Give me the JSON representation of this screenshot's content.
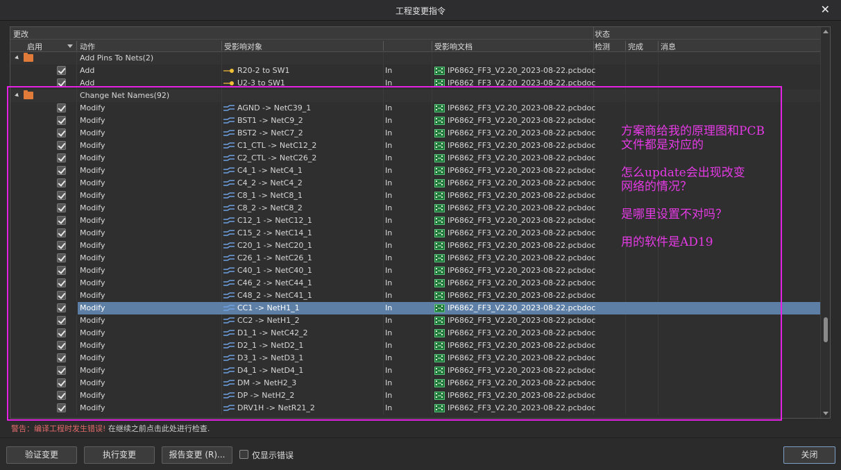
{
  "window": {
    "title": "工程变更指令",
    "close_glyph": "✕"
  },
  "group_headers": {
    "changes": "更改",
    "status": "状态"
  },
  "columns": {
    "enable": "启用",
    "action": "动作",
    "affected_object": "受影响对象",
    "affected_document": "受影响文档",
    "check": "检测",
    "done": "完成",
    "message": "消息"
  },
  "groups": [
    {
      "title": "Add Pins To Nets(2)",
      "rows": [
        {
          "action": "Add",
          "object": "R20-2 to SW1",
          "dir": "In",
          "doc": "IP6862_FF3_V2.20_2023-08-22.pcbdoc",
          "icon": "pin"
        },
        {
          "action": "Add",
          "object": "U2-3 to SW1",
          "dir": "In",
          "doc": "IP6862_FF3_V2.20_2023-08-22.pcbdoc",
          "icon": "pin"
        }
      ]
    },
    {
      "title": "Change Net Names(92)",
      "rows": [
        {
          "action": "Modify",
          "object": "AGND -> NetC39_1",
          "dir": "In",
          "doc": "IP6862_FF3_V2.20_2023-08-22.pcbdoc",
          "icon": "net"
        },
        {
          "action": "Modify",
          "object": "BST1 -> NetC9_2",
          "dir": "In",
          "doc": "IP6862_FF3_V2.20_2023-08-22.pcbdoc",
          "icon": "net"
        },
        {
          "action": "Modify",
          "object": "BST2 -> NetC7_2",
          "dir": "In",
          "doc": "IP6862_FF3_V2.20_2023-08-22.pcbdoc",
          "icon": "net"
        },
        {
          "action": "Modify",
          "object": "C1_CTL -> NetC12_2",
          "dir": "In",
          "doc": "IP6862_FF3_V2.20_2023-08-22.pcbdoc",
          "icon": "net"
        },
        {
          "action": "Modify",
          "object": "C2_CTL -> NetC26_2",
          "dir": "In",
          "doc": "IP6862_FF3_V2.20_2023-08-22.pcbdoc",
          "icon": "net"
        },
        {
          "action": "Modify",
          "object": "C4_1 -> NetC4_1",
          "dir": "In",
          "doc": "IP6862_FF3_V2.20_2023-08-22.pcbdoc",
          "icon": "net"
        },
        {
          "action": "Modify",
          "object": "C4_2 -> NetC4_2",
          "dir": "In",
          "doc": "IP6862_FF3_V2.20_2023-08-22.pcbdoc",
          "icon": "net"
        },
        {
          "action": "Modify",
          "object": "C8_1 -> NetC8_1",
          "dir": "In",
          "doc": "IP6862_FF3_V2.20_2023-08-22.pcbdoc",
          "icon": "net"
        },
        {
          "action": "Modify",
          "object": "C8_2 -> NetC8_2",
          "dir": "In",
          "doc": "IP6862_FF3_V2.20_2023-08-22.pcbdoc",
          "icon": "net"
        },
        {
          "action": "Modify",
          "object": "C12_1 -> NetC12_1",
          "dir": "In",
          "doc": "IP6862_FF3_V2.20_2023-08-22.pcbdoc",
          "icon": "net"
        },
        {
          "action": "Modify",
          "object": "C15_2 -> NetC14_1",
          "dir": "In",
          "doc": "IP6862_FF3_V2.20_2023-08-22.pcbdoc",
          "icon": "net"
        },
        {
          "action": "Modify",
          "object": "C20_1 -> NetC20_1",
          "dir": "In",
          "doc": "IP6862_FF3_V2.20_2023-08-22.pcbdoc",
          "icon": "net"
        },
        {
          "action": "Modify",
          "object": "C26_1 -> NetC26_1",
          "dir": "In",
          "doc": "IP6862_FF3_V2.20_2023-08-22.pcbdoc",
          "icon": "net"
        },
        {
          "action": "Modify",
          "object": "C40_1 -> NetC40_1",
          "dir": "In",
          "doc": "IP6862_FF3_V2.20_2023-08-22.pcbdoc",
          "icon": "net"
        },
        {
          "action": "Modify",
          "object": "C46_2 -> NetC44_1",
          "dir": "In",
          "doc": "IP6862_FF3_V2.20_2023-08-22.pcbdoc",
          "icon": "net"
        },
        {
          "action": "Modify",
          "object": "C48_2 -> NetC41_1",
          "dir": "In",
          "doc": "IP6862_FF3_V2.20_2023-08-22.pcbdoc",
          "icon": "net"
        },
        {
          "action": "Modify",
          "object": "CC1 -> NetH1_1",
          "dir": "In",
          "doc": "IP6862_FF3_V2.20_2023-08-22.pcbdoc",
          "icon": "net",
          "selected": true
        },
        {
          "action": "Modify",
          "object": "CC2 -> NetH1_2",
          "dir": "In",
          "doc": "IP6862_FF3_V2.20_2023-08-22.pcbdoc",
          "icon": "net"
        },
        {
          "action": "Modify",
          "object": "D1_1 -> NetC42_2",
          "dir": "In",
          "doc": "IP6862_FF3_V2.20_2023-08-22.pcbdoc",
          "icon": "net"
        },
        {
          "action": "Modify",
          "object": "D2_1 -> NetD2_1",
          "dir": "In",
          "doc": "IP6862_FF3_V2.20_2023-08-22.pcbdoc",
          "icon": "net"
        },
        {
          "action": "Modify",
          "object": "D3_1 -> NetD3_1",
          "dir": "In",
          "doc": "IP6862_FF3_V2.20_2023-08-22.pcbdoc",
          "icon": "net"
        },
        {
          "action": "Modify",
          "object": "D4_1 -> NetD4_1",
          "dir": "In",
          "doc": "IP6862_FF3_V2.20_2023-08-22.pcbdoc",
          "icon": "net"
        },
        {
          "action": "Modify",
          "object": "DM -> NetH2_3",
          "dir": "In",
          "doc": "IP6862_FF3_V2.20_2023-08-22.pcbdoc",
          "icon": "net"
        },
        {
          "action": "Modify",
          "object": "DP -> NetH2_2",
          "dir": "In",
          "doc": "IP6862_FF3_V2.20_2023-08-22.pcbdoc",
          "icon": "net"
        },
        {
          "action": "Modify",
          "object": "DRV1H -> NetR21_2",
          "dir": "In",
          "doc": "IP6862_FF3_V2.20_2023-08-22.pcbdoc",
          "icon": "net"
        }
      ]
    }
  ],
  "annotation": {
    "color": "#e53ae5",
    "lines": [
      "方案商给我的原理图和PCB",
      "文件都是对应的",
      "怎么update会出现改变",
      "网络的情况？",
      "是哪里设置不对吗？",
      "用的软件是AD19"
    ]
  },
  "warning": {
    "prefix": "警告：编译工程时发生错误!",
    "suffix": "在继续之前点击此处进行检查."
  },
  "footer": {
    "validate": "验证变更",
    "execute": "执行变更",
    "report": "报告变更 (R)...",
    "only_errors": "仅显示错误",
    "close": "关闭"
  },
  "colors": {
    "selection": "#5d7fa6",
    "folder": "#e07b3a",
    "warning": "#e26a6a",
    "annotation": "#e53ae5"
  }
}
